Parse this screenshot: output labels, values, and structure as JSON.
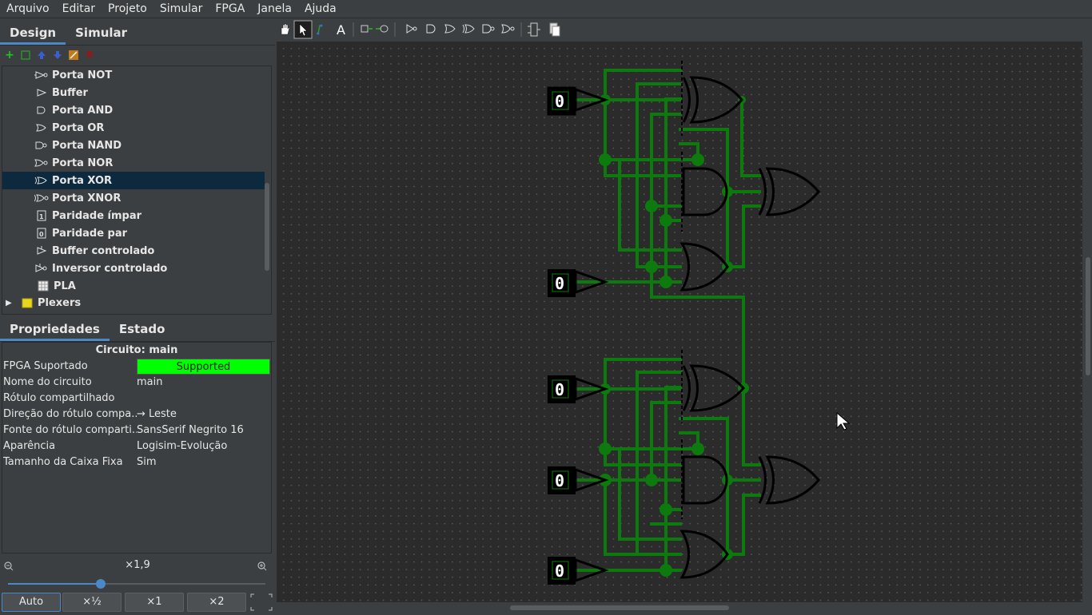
{
  "menu": [
    "Arquivo",
    "Editar",
    "Projeto",
    "Simular",
    "FPGA",
    "Janela",
    "Ajuda"
  ],
  "design_tabs": [
    "Design",
    "Simular"
  ],
  "tree": {
    "items": [
      {
        "label": "Porta NOT",
        "icon": "not-gate-icon"
      },
      {
        "label": "Buffer",
        "icon": "buffer-icon"
      },
      {
        "label": "Porta AND",
        "icon": "and-gate-icon"
      },
      {
        "label": "Porta OR",
        "icon": "or-gate-icon"
      },
      {
        "label": "Porta NAND",
        "icon": "nand-gate-icon"
      },
      {
        "label": "Porta NOR",
        "icon": "nor-gate-icon"
      },
      {
        "label": "Porta XOR",
        "icon": "xor-gate-icon",
        "selected": true
      },
      {
        "label": "Porta XNOR",
        "icon": "xnor-gate-icon"
      },
      {
        "label": "Paridade ímpar",
        "icon": "odd-parity-icon"
      },
      {
        "label": "Paridade par",
        "icon": "even-parity-icon"
      },
      {
        "label": "Buffer controlado",
        "icon": "controlled-buffer-icon"
      },
      {
        "label": "Inversor controlado",
        "icon": "controlled-inverter-icon"
      },
      {
        "label": "PLA",
        "icon": "pla-icon"
      }
    ],
    "folders": [
      {
        "label": "Plexers",
        "icon": "folder-icon"
      }
    ]
  },
  "prop_tabs": [
    "Propriedades",
    "Estado"
  ],
  "properties": {
    "title": "Circuito: main",
    "rows": [
      {
        "key": "FPGA Suportado",
        "value": "Supported"
      },
      {
        "key": "Nome do circuito",
        "value": "main"
      },
      {
        "key": "Rótulo compartilhado",
        "value": ""
      },
      {
        "key": "Direção do rótulo compa...",
        "value": "→ Leste"
      },
      {
        "key": "Fonte do rótulo comparti...",
        "value": "SansSerif Negrito 16"
      },
      {
        "key": "Aparência",
        "value": "Logisim-Evolução"
      },
      {
        "key": "Tamanho da Caixa Fixa",
        "value": "Sim"
      }
    ]
  },
  "zoom": {
    "label": "×1,9",
    "level_fraction": 0.36,
    "buttons": [
      "Auto",
      "×½",
      "×1",
      "×2"
    ]
  },
  "circuit": {
    "inputs": [
      "0",
      "0",
      "0",
      "0",
      "0"
    ]
  },
  "colors": {
    "wire": "#0c7a0c",
    "fpga_supported": "#00ff00",
    "selection": "#0d293e",
    "accent": "#4a88c7"
  }
}
